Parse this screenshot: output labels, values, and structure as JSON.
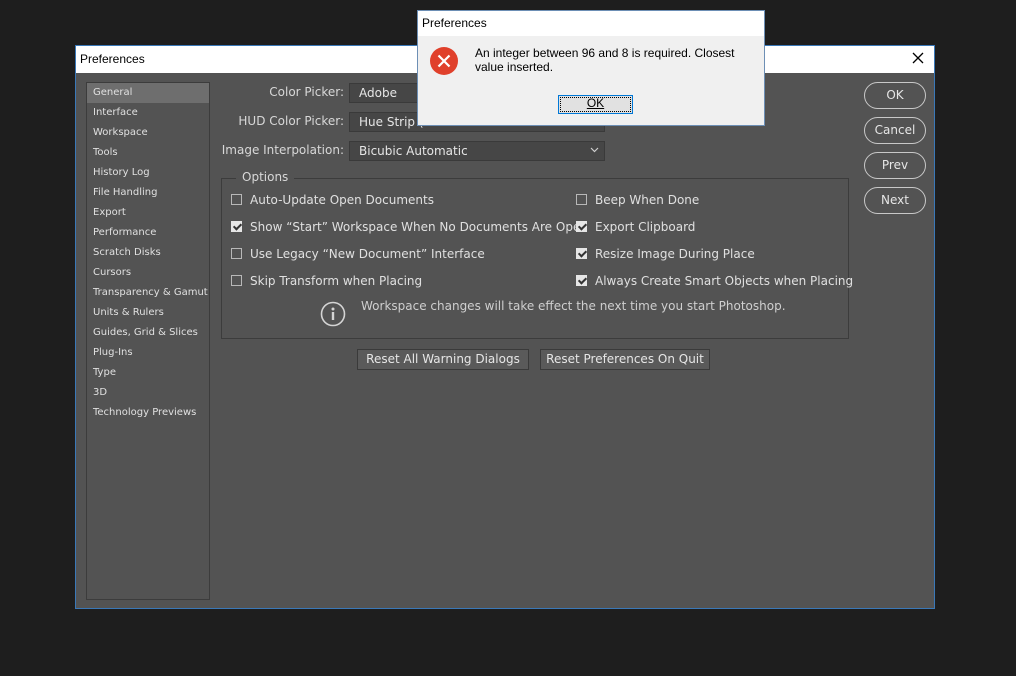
{
  "window": {
    "title": "Preferences"
  },
  "sidebar": {
    "items": [
      {
        "label": "General",
        "selected": true
      },
      {
        "label": "Interface"
      },
      {
        "label": "Workspace"
      },
      {
        "label": "Tools"
      },
      {
        "label": "History Log"
      },
      {
        "label": "File Handling"
      },
      {
        "label": "Export"
      },
      {
        "label": "Performance"
      },
      {
        "label": "Scratch Disks"
      },
      {
        "label": "Cursors"
      },
      {
        "label": "Transparency & Gamut"
      },
      {
        "label": "Units & Rulers"
      },
      {
        "label": "Guides, Grid & Slices"
      },
      {
        "label": "Plug-Ins"
      },
      {
        "label": "Type"
      },
      {
        "label": "3D"
      },
      {
        "label": "Technology Previews"
      }
    ]
  },
  "form": {
    "color_picker": {
      "label": "Color Picker:",
      "value": "Adobe"
    },
    "hud_color_picker": {
      "label": "HUD Color Picker:",
      "value": "Hue Strip ("
    },
    "image_interpolation": {
      "label": "Image Interpolation:",
      "value": "Bicubic Automatic"
    }
  },
  "options": {
    "legend": "Options",
    "items": [
      {
        "label": "Auto-Update Open Documents",
        "checked": false
      },
      {
        "label": "Show “Start” Workspace When No Documents Are Open",
        "checked": true
      },
      {
        "label": "Use Legacy “New Document” Interface",
        "checked": false
      },
      {
        "label": "Skip Transform when Placing",
        "checked": false
      },
      {
        "label": "Beep When Done",
        "checked": false
      },
      {
        "label": "Export Clipboard",
        "checked": true
      },
      {
        "label": "Resize Image During Place",
        "checked": true
      },
      {
        "label": "Always Create Smart Objects when Placing",
        "checked": true
      }
    ],
    "info": "Workspace changes will take effect the next time you start Photoshop."
  },
  "buttons": {
    "reset_warnings": "Reset All Warning Dialogs",
    "reset_prefs": "Reset Preferences On Quit",
    "ok": "OK",
    "cancel": "Cancel",
    "prev": "Prev",
    "next": "Next"
  },
  "alert": {
    "title": "Preferences",
    "message": "An integer between 96 and 8 is required.  Closest value inserted.",
    "ok": "OK"
  },
  "colors": {
    "dialog_bg": "#535353",
    "accent_border": "#3a78b8",
    "error_red": "#e0402b"
  },
  "icons": [
    "close-icon",
    "chevron-down-icon",
    "info-icon",
    "error-icon"
  ]
}
